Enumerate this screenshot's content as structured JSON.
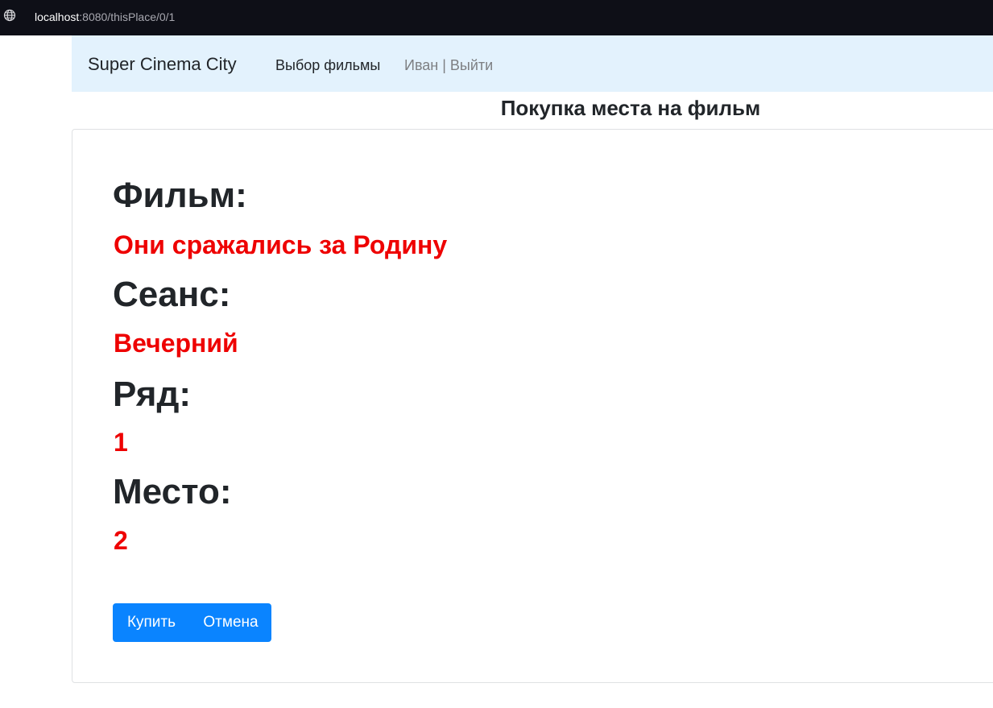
{
  "browser": {
    "url_host": "localhost",
    "url_path": ":8080/thisPlace/0/1"
  },
  "navbar": {
    "brand": "Super Cinema City",
    "movies_link": "Выбор фильмы",
    "user_link": "Иван | Выйти"
  },
  "page": {
    "heading": "Покупка места на фильм"
  },
  "ticket": {
    "film_label": "Фильм:",
    "film_value": "Они сражались за Родину",
    "seance_label": "Сеанс:",
    "seance_value": "Вечерний",
    "row_label": "Ряд:",
    "row_value": "1",
    "place_label": "Место:",
    "place_value": "2"
  },
  "actions": {
    "buy_label": "Купить",
    "cancel_label": "Отмена"
  },
  "colors": {
    "navbar_bg": "#e3f2fd",
    "value_red": "#ee0000",
    "button_blue": "#0a84ff",
    "addressbar_bg": "#0e0f17"
  },
  "icons": {
    "address_bar": "globe-icon"
  }
}
